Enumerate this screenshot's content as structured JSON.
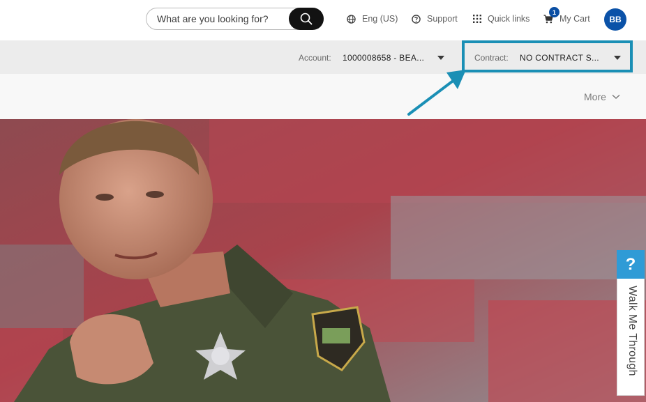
{
  "header": {
    "search": {
      "placeholder": "What are you looking for?"
    },
    "language": {
      "label": "Eng (US)",
      "icon": "globe-icon"
    },
    "support": {
      "label": "Support",
      "icon": "question-circle-icon"
    },
    "quick_links": {
      "label": "Quick links",
      "icon": "grid-icon"
    },
    "cart": {
      "label": "My Cart",
      "icon": "cart-icon",
      "count": "1"
    },
    "avatar": {
      "initials": "BB",
      "color": "#0b52a8"
    }
  },
  "account_bar": {
    "account_label": "Account:",
    "account_value": "1000008658 - BEA...",
    "contract_label": "Contract:",
    "contract_value": "NO CONTRACT S...",
    "highlight_color": "#1a8fb5"
  },
  "subnav": {
    "more_label": "More"
  },
  "help_widget": {
    "icon_label": "?",
    "label": "Walk Me Through",
    "color": "#2f9bd6"
  }
}
